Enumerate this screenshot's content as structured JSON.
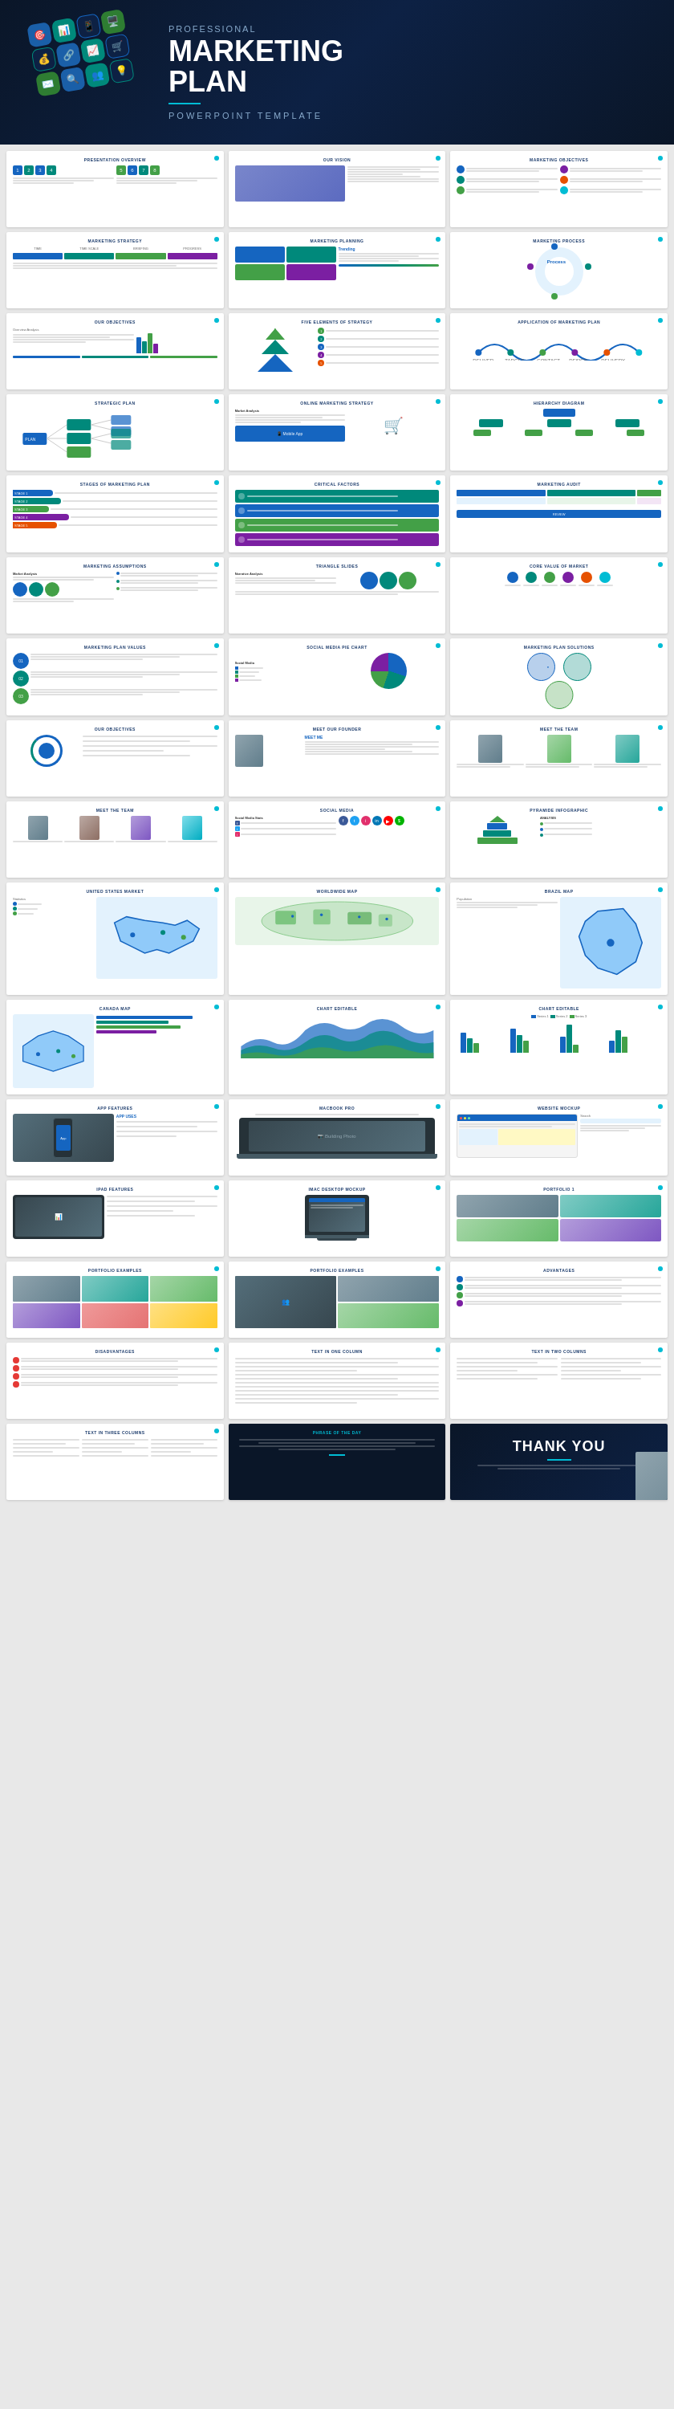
{
  "cover": {
    "pre_title": "PROFESSIONAL",
    "title_line1": "MARKETING",
    "title_line2": "PLAN",
    "tagline": "POWERPOINT TEMPLATE"
  },
  "slides": [
    {
      "id": 1,
      "title": "PRESENTATION OVERVIEW",
      "type": "overview"
    },
    {
      "id": 2,
      "title": "OUR VISION",
      "type": "vision"
    },
    {
      "id": 3,
      "title": "MARKETING OBJECTIVES",
      "type": "objectives"
    },
    {
      "id": 4,
      "title": "MARKETING STRATEGY",
      "type": "strategy"
    },
    {
      "id": 5,
      "title": "MARKETING PLANNING",
      "type": "planning"
    },
    {
      "id": 6,
      "title": "MARKETING PROCESS",
      "type": "process"
    },
    {
      "id": 7,
      "title": "OUR OBJECTIVES",
      "type": "objectives2"
    },
    {
      "id": 8,
      "title": "FIVE ELEMENTS OF STRATEGY",
      "type": "elements"
    },
    {
      "id": 9,
      "title": "APPLICATION OF MARKETING PLAN",
      "type": "application"
    },
    {
      "id": 10,
      "title": "STRATEGIC PLAN",
      "type": "strategic"
    },
    {
      "id": 11,
      "title": "ONLINE MARKETING STRATEGY",
      "type": "online"
    },
    {
      "id": 12,
      "title": "HIERARCHY DIAGRAM",
      "type": "hierarchy"
    },
    {
      "id": 13,
      "title": "STAGES OF MARKETING PLAN",
      "type": "stages"
    },
    {
      "id": 14,
      "title": "CRITICAL FACTORS",
      "type": "critical"
    },
    {
      "id": 15,
      "title": "MARKETING AUDIT",
      "type": "audit"
    },
    {
      "id": 16,
      "title": "MARKETING ASSUMPTIONS",
      "type": "assumptions"
    },
    {
      "id": 17,
      "title": "TRIANGLE SLIDES",
      "type": "triangle"
    },
    {
      "id": 18,
      "title": "CORE VALUE OF MARKET",
      "type": "corevalue"
    },
    {
      "id": 19,
      "title": "MARKETING PLAN VALUES",
      "type": "values"
    },
    {
      "id": 20,
      "title": "SOCIAL MEDIA PIE CHART",
      "type": "piechart"
    },
    {
      "id": 21,
      "title": "MARKETING PLAN SOLUTIONS",
      "type": "solutions"
    },
    {
      "id": 22,
      "title": "OUR OBJECTIVES",
      "type": "objectives3"
    },
    {
      "id": 23,
      "title": "MEET OUR FOUNDER",
      "type": "founder"
    },
    {
      "id": 24,
      "title": "MEET THE TEAM",
      "type": "team"
    },
    {
      "id": 25,
      "title": "MEET THE TEAM",
      "type": "team2"
    },
    {
      "id": 26,
      "title": "SOCIAL MEDIA",
      "type": "socialmedia"
    },
    {
      "id": 27,
      "title": "PYRAMIDE INFOGRAPHIC",
      "type": "pyramid"
    },
    {
      "id": 28,
      "title": "UNITED STATES MARKET",
      "type": "usmap"
    },
    {
      "id": 29,
      "title": "WORLDWIDE MAP",
      "type": "worldmap"
    },
    {
      "id": 30,
      "title": "BRAZIL MAP",
      "type": "brazilmap"
    },
    {
      "id": 31,
      "title": "CANADA MAP",
      "type": "canadamap"
    },
    {
      "id": 32,
      "title": "CHART EDITABLE",
      "type": "chart1"
    },
    {
      "id": 33,
      "title": "CHART EDITABLE",
      "type": "chart2"
    },
    {
      "id": 34,
      "title": "APP FEATURES",
      "type": "app"
    },
    {
      "id": 35,
      "title": "MACBOOK PRO",
      "type": "macbook"
    },
    {
      "id": 36,
      "title": "WEBSITE MOCKUP",
      "type": "website"
    },
    {
      "id": 37,
      "title": "IPAD FEATURES",
      "type": "ipad"
    },
    {
      "id": 38,
      "title": "IMAC DESKTOP MOCKUP",
      "type": "imac"
    },
    {
      "id": 39,
      "title": "PORTFOLIO 1",
      "type": "portfolio1"
    },
    {
      "id": 40,
      "title": "PORTFOLIO EXAMPLES",
      "type": "portfolio2"
    },
    {
      "id": 41,
      "title": "PORTFOLIO EXAMPLES",
      "type": "portfolio3"
    },
    {
      "id": 42,
      "title": "ADVANTAGES",
      "type": "advantages"
    },
    {
      "id": 43,
      "title": "DISADVANTAGES",
      "type": "disadvantages"
    },
    {
      "id": 44,
      "title": "TEXT IN ONE COLUMN",
      "type": "text1"
    },
    {
      "id": 45,
      "title": "TEXT IN TWO COLUMNS",
      "type": "text2"
    },
    {
      "id": 46,
      "title": "TEXT IN THREE COLUMNS",
      "type": "text3"
    },
    {
      "id": 47,
      "title": "Phrase Of The Day",
      "type": "phrase",
      "dark": true
    },
    {
      "id": 48,
      "title": "THANK YOU",
      "type": "thankyou"
    }
  ],
  "colors": {
    "primary": "#1565c0",
    "teal": "#00897b",
    "green": "#43a047",
    "dark_bg": "#0a1628",
    "accent": "#00bcd4"
  }
}
